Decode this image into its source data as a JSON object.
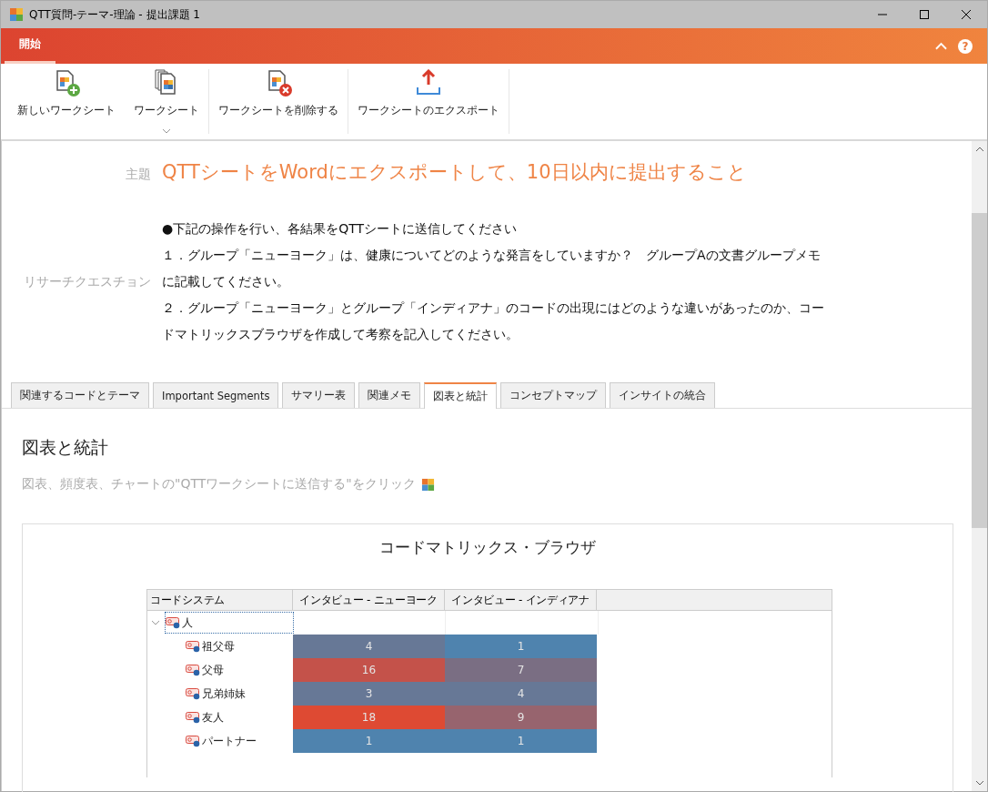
{
  "window": {
    "title": "QTT質問-テーマ-理論 - 提出課題 1"
  },
  "ribbon": {
    "tabs": [
      {
        "label": "開始",
        "selected": true
      }
    ],
    "help": "?"
  },
  "toolbar": [
    {
      "kind": "new",
      "label": "新しいワークシート"
    },
    {
      "kind": "sheets",
      "label": "ワークシート",
      "dropdown": true
    },
    {
      "kind": "delete",
      "label": "ワークシートを削除する"
    },
    {
      "kind": "export",
      "label": "ワークシートのエクスポート"
    }
  ],
  "subject": {
    "label": "主題",
    "text": "QTTシートをWordにエクスポートして、10日以内に提出すること"
  },
  "research_question": {
    "label": "リサーチクエスチョン",
    "lines": [
      "●下記の操作を行い、各結果をQTTシートに送信してください",
      "１．グループ「ニューヨーク」は、健康についてどのような発言をしていますか？　グループAの文書グループメモに記載してください。",
      "２．グループ「ニューヨーク」とグループ「インディアナ」のコードの出現にはどのような違いがあったのか、コードマトリックスブラウザを作成して考察を記入してください。"
    ]
  },
  "tabs": [
    {
      "label": "関連するコードとテーマ",
      "selected": false
    },
    {
      "label": "Important Segments",
      "selected": false
    },
    {
      "label": "サマリー表",
      "selected": false
    },
    {
      "label": "関連メモ",
      "selected": false
    },
    {
      "label": "図表と統計",
      "selected": true
    },
    {
      "label": "コンセプトマップ",
      "selected": false
    },
    {
      "label": "インサイトの統合",
      "selected": false
    }
  ],
  "section": {
    "heading": "図表と統計",
    "hint": "図表、頻度表、チャートの\"QTTワークシートに送信する\"をクリック"
  },
  "matrix": {
    "title": "コードマトリックス・ブラウザ",
    "columns": [
      "コードシステム",
      "インタビュー - ニューヨーク",
      "インタビュー - インディアナ"
    ],
    "rows": [
      {
        "code": "人",
        "expanded": true,
        "selected": true,
        "children": [
          {
            "code": "祖父母",
            "cells": [
              {
                "value": "4",
                "color": "#677896"
              },
              {
                "value": "1",
                "color": "#4f83ae"
              }
            ]
          },
          {
            "code": "父母",
            "cells": [
              {
                "value": "16",
                "color": "#c4524a"
              },
              {
                "value": "7",
                "color": "#7a6e83"
              }
            ]
          },
          {
            "code": "兄弟姉妹",
            "cells": [
              {
                "value": "3",
                "color": "#677896"
              },
              {
                "value": "4",
                "color": "#677896"
              }
            ]
          },
          {
            "code": "友人",
            "cells": [
              {
                "value": "18",
                "color": "#de4a33"
              },
              {
                "value": "9",
                "color": "#97646e"
              }
            ]
          },
          {
            "code": "パートナー",
            "cells": [
              {
                "value": "1",
                "color": "#4f83ae"
              },
              {
                "value": "1",
                "color": "#4f83ae"
              }
            ]
          }
        ]
      }
    ]
  }
}
